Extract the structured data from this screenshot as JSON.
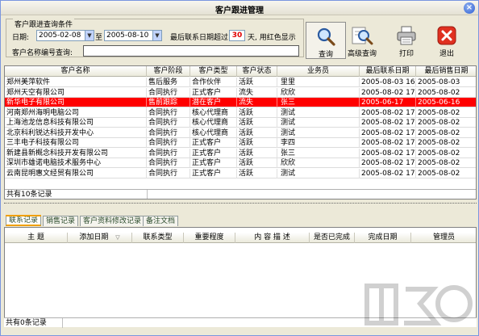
{
  "window": {
    "title": "客户跟进管理",
    "close": "×"
  },
  "filter": {
    "group_label": "客户跟进查询条件",
    "date_label": "日期:",
    "date_from": "2005-02-08",
    "to_label": "至",
    "date_to": "2005-08-10",
    "days_prefix": "最后联系日期超过",
    "days_value": "30",
    "days_suffix": "天, 用红色显示",
    "name_label": "客户名称编号查询:",
    "name_value": ""
  },
  "toolbar": {
    "query": "查询",
    "advanced": "高级查询",
    "print": "打印",
    "exit": "退出"
  },
  "customers": {
    "columns": [
      "客户名称",
      "客户阶段",
      "客户类型",
      "客户状态",
      "业务员",
      "最后联系日期",
      "最后销售日期"
    ],
    "rows": [
      [
        "郑州美萍软件",
        "售后服务",
        "合作伙伴",
        "活跃",
        "里里",
        "2005-08-03 16:4",
        "2005-08-03",
        false
      ],
      [
        "郑州天空有限公司",
        "合同执行",
        "正式客户",
        "流失",
        "欣欣",
        "2005-08-02 17:1",
        "2005-08-02",
        false
      ],
      [
        "新华电子有限公司",
        "售前跟踪",
        "潜在客户",
        "流失",
        "张三",
        "2005-06-17",
        "2005-06-16",
        true
      ],
      [
        "河南郑州海明电脑公司",
        "合同执行",
        "核心代理商",
        "活跃",
        "测试",
        "2005-08-02 17:1",
        "2005-08-02",
        false
      ],
      [
        "上海池龙信息科技有限公司",
        "合同执行",
        "核心代理商",
        "活跃",
        "测试",
        "2005-08-02 17:1",
        "2005-08-02",
        false
      ],
      [
        "北京科利锐达科技开发中心",
        "合同执行",
        "核心代理商",
        "活跃",
        "测试",
        "2005-08-02 17:1",
        "2005-08-02",
        false
      ],
      [
        "三丰电子科技有限公司",
        "合同执行",
        "正式客户",
        "活跃",
        "李四",
        "2005-08-02 17:0",
        "2005-08-02",
        false
      ],
      [
        "新建县新概念科技开发有限公司",
        "合同执行",
        "正式客户",
        "活跃",
        "张三",
        "2005-08-02 17:0",
        "2005-08-02",
        false
      ],
      [
        "深圳市雄诺电脑技术服务中心",
        "合同执行",
        "正式客户",
        "活跃",
        "欣欣",
        "2005-08-02 17:1",
        "2005-08-02",
        false
      ],
      [
        "云南昆明惠文经贸有限公司",
        "合同执行",
        "正式客户",
        "活跃",
        "测试",
        "2005-08-02 17:1",
        "2005-08-02",
        false
      ]
    ],
    "summary": "共有10条记录"
  },
  "tabs": [
    "联系记录",
    "销售记录",
    "客户资料修改记录",
    "备注文档"
  ],
  "contacts": {
    "columns": [
      "主  题",
      "添加日期",
      "联系类型",
      "重要程度",
      "内 容 描 述",
      "是否已完成",
      "完成日期",
      "管理员"
    ],
    "summary": "共有0条记录"
  },
  "colors": {
    "highlight": "#ff0000",
    "days_value": "#e00000",
    "tab_active": "#f0a000"
  }
}
